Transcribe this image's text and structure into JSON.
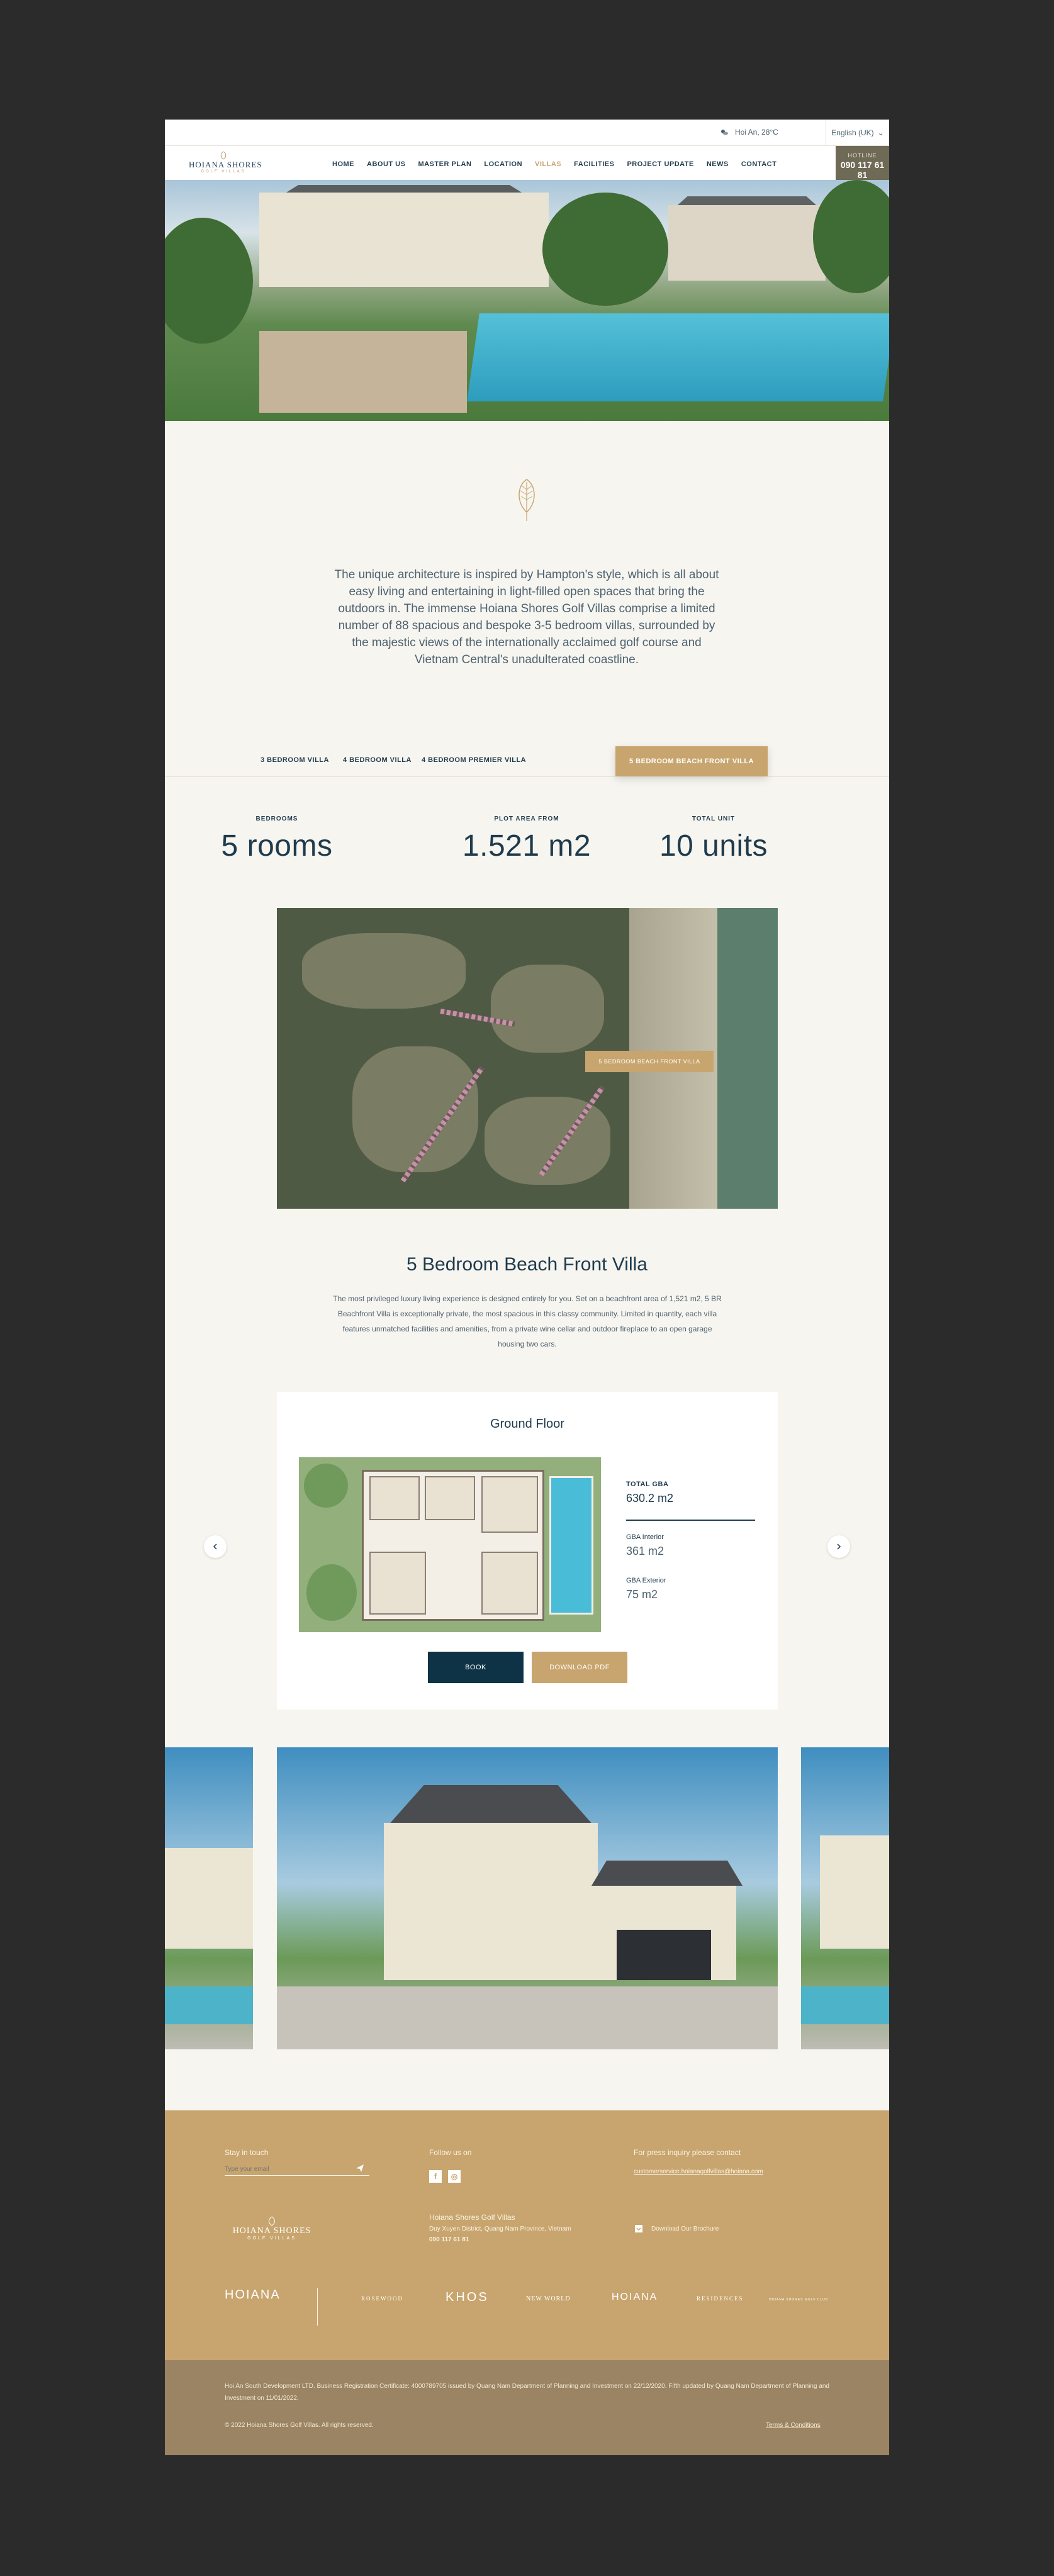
{
  "topbar": {
    "weather": "Hoi An, 28°C",
    "language": "English (UK)"
  },
  "logo": {
    "line1": "HOIANA SHORES",
    "line2": "GOLF VILLAS"
  },
  "nav": [
    "HOME",
    "ABOUT US",
    "MASTER PLAN",
    "LOCATION",
    "VILLAS",
    "FACILITIES",
    "PROJECT UPDATE",
    "NEWS",
    "CONTACT"
  ],
  "hotline": {
    "label": "HOTLINE",
    "number": "090 117 61 81"
  },
  "intro": "The unique architecture is inspired by Hampton's style, which is all about easy living and entertaining in light-filled open spaces that bring the outdoors in. The immense Hoiana Shores Golf Villas comprise a limited number of 88 spacious and bespoke 3-5 bedroom villas, surrounded by the majestic views of the internationally acclaimed golf course and Vietnam Central's unadulterated coastline.",
  "tabs": [
    "3 BEDROOM VILLA",
    "4 BEDROOM VILLA",
    "4 BEDROOM PREMIER VILLA",
    "5 BEDROOM BEACH FRONT VILLA"
  ],
  "stats": [
    {
      "label": "BEDROOMS",
      "value": "5 rooms"
    },
    {
      "label": "PLOT AREA FROM",
      "value": "1.521 m2"
    },
    {
      "label": "TOTAL UNIT",
      "value": "10 units"
    }
  ],
  "plan_badge": "5 BEDROOM BEACH FRONT VILLA",
  "villa": {
    "title": "5 Bedroom Beach Front Villa",
    "description": "The most privileged luxury living experience is designed entirely for you. Set on a beachfront area of 1,521 m2, 5 BR Beachfront Villa is exceptionally private, the most spacious in this classy community. Limited in quantity, each villa features unmatched facilities and amenities, from a private wine cellar and outdoor fireplace to an open garage housing two cars."
  },
  "floor": {
    "title": "Ground Floor",
    "total_label": "TOTAL GBA",
    "total_value": "630.2 m2",
    "interior_label": "GBA Interior",
    "interior_value": "361 m2",
    "exterior_label": "GBA Exterior",
    "exterior_value": "75 m2",
    "book": "BOOK",
    "download": "DOWNLOAD PDF"
  },
  "footer": {
    "stay_title": "Stay in touch",
    "email_placeholder": "Type your email",
    "follow_title": "Follow us on",
    "press_title": "For press inquiry please contact",
    "press_email": "customerservice.hoianagolfvillas@hoiana.com",
    "company": "Hoiana Shores Golf Villas",
    "address": "Duy Xuyen District, Quang Nam Province, Vietnam",
    "phone": "090 117 61 81",
    "brochure": "Download Our Brochure",
    "partners": [
      "HOIANA",
      "ROSEWOOD",
      "KHOS",
      "NEW WORLD",
      "HOIANA",
      "RESIDENCES",
      "HOIANA SHORES GOLF CLUB"
    ],
    "legal": "Hoi An South Development LTD. Business Registration Certificate: 4000789705 issued by Quang Nam Department of Planning and Investment on 22/12/2020. Fifth updated by Quang Nam Department of Planning and Investment on 11/01/2022.",
    "copyright": "© 2022 Hoiana Shores Golf Villas. All rights reserved.",
    "terms": "Terms & Conditions"
  },
  "colors": {
    "gold": "#c8a56e",
    "navy": "#0f3346",
    "cream": "#f7f5ef"
  }
}
